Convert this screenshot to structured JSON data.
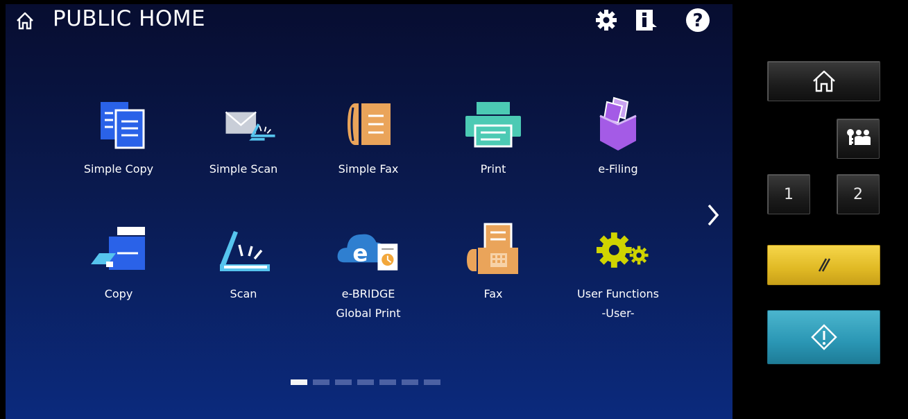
{
  "header": {
    "title": "PUBLIC HOME",
    "icons": [
      "home-icon",
      "settings-gear-icon",
      "info-icon",
      "help-icon"
    ]
  },
  "tiles": [
    {
      "label": "Simple Copy",
      "icon": "simple-copy-icon"
    },
    {
      "label": "Simple Scan",
      "icon": "simple-scan-icon"
    },
    {
      "label": "Simple Fax",
      "icon": "simple-fax-icon"
    },
    {
      "label": "Print",
      "icon": "print-icon"
    },
    {
      "label": "e-Filing",
      "icon": "e-filing-icon"
    },
    {
      "label": "Copy",
      "icon": "copy-icon"
    },
    {
      "label": "Scan",
      "icon": "scan-icon"
    },
    {
      "label": "e-BRIDGE\nGlobal Print",
      "icon": "e-bridge-global-print-icon"
    },
    {
      "label": "Fax",
      "icon": "fax-icon"
    },
    {
      "label": "User Functions\n-User-",
      "icon": "user-functions-icon"
    }
  ],
  "pager": {
    "pages": 7,
    "current": 1
  },
  "side_panel": {
    "home_button_icon": "home-icon",
    "access_button_icon": "user-access-icon",
    "button_1": "1",
    "button_2": "2",
    "reset_button_icon": "reset-icon",
    "start_button_icon": "start-icon"
  },
  "colors": {
    "copy_blue": "#2a62e8",
    "scan_blue": "#56c4ee",
    "fax_orange": "#eaa45a",
    "print_teal": "#4ccab4",
    "efiling_purple": "#a45be6",
    "gear_yellow": "#d0d400",
    "reset_yellow": "#e9c531",
    "start_teal": "#2f9cb9"
  }
}
